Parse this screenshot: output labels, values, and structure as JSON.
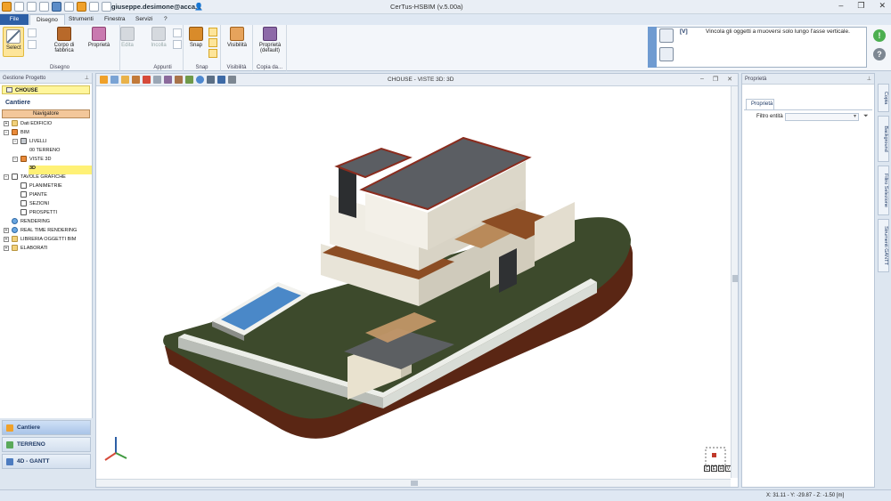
{
  "titlebar": {
    "user": "giuseppe.desimone@acca.it",
    "app_title": "CerTus-HSBIM (v.5.00a)"
  },
  "menu": {
    "tabs": [
      "File",
      "Disegno",
      "Strumenti",
      "Finestra",
      "Servizi",
      "?"
    ],
    "active": "Disegno"
  },
  "ribbon": {
    "select": "Select",
    "corpo": "Corpo di fabbrica",
    "proprieta": "Proprietà",
    "edita": "Edita",
    "incolla": "Incolla",
    "snap": "Snap",
    "visibilita": "Visibilità",
    "proprieta_default": "Proprietà (default)",
    "groups": {
      "disegno": "Disegno",
      "appunti": "Appunti",
      "snap": "Snap",
      "visibilita": "Visibilità",
      "copia": "Copia da..."
    }
  },
  "help": {
    "code": "[V]",
    "text": "Vincola gli oggetti a muoversi solo lungo l'asse verticale."
  },
  "left_panel": {
    "header": "Gestione Progetto",
    "project": "CHOUSE",
    "cantiere": "Cantiere",
    "navigator": "Navigatore",
    "tree": [
      {
        "label": "Dati EDIFICIO"
      },
      {
        "label": "BIM"
      },
      {
        "label": "LIVELLI"
      },
      {
        "label": "00 TERRENO"
      },
      {
        "label": "VISTE 3D"
      },
      {
        "label": "3D"
      },
      {
        "label": "TAVOLE GRAFICHE"
      },
      {
        "label": "PLANIMETRIE"
      },
      {
        "label": "PIANTE"
      },
      {
        "label": "SEZIONI"
      },
      {
        "label": "PROSPETTI"
      },
      {
        "label": "RENDERING"
      },
      {
        "label": "REAL TIME RENDERING"
      },
      {
        "label": "LIBRERIA OGGETTI BIM"
      },
      {
        "label": "ELABORATI"
      }
    ],
    "bottom_items": [
      "Cantiere",
      "TERRENO",
      "4D - GANTT"
    ]
  },
  "viewport": {
    "title": "CHOUSE - VISTE 3D: 3D",
    "cube_letters": [
      "C",
      "E",
      "H",
      "V"
    ]
  },
  "right_panel": {
    "header": "Proprietà",
    "tab": "Proprietà",
    "filter_label": "Filtro entità"
  },
  "side_tabs": [
    "Copia",
    "Background",
    "Filtro Selezione",
    "Strumenti GANTT"
  ],
  "status": {
    "coords": "X: 31.11 - Y: -29.87 - Z: -1.50 [m]"
  },
  "colors": {
    "accent": "#2d5fa6",
    "highlight": "#fff176"
  }
}
